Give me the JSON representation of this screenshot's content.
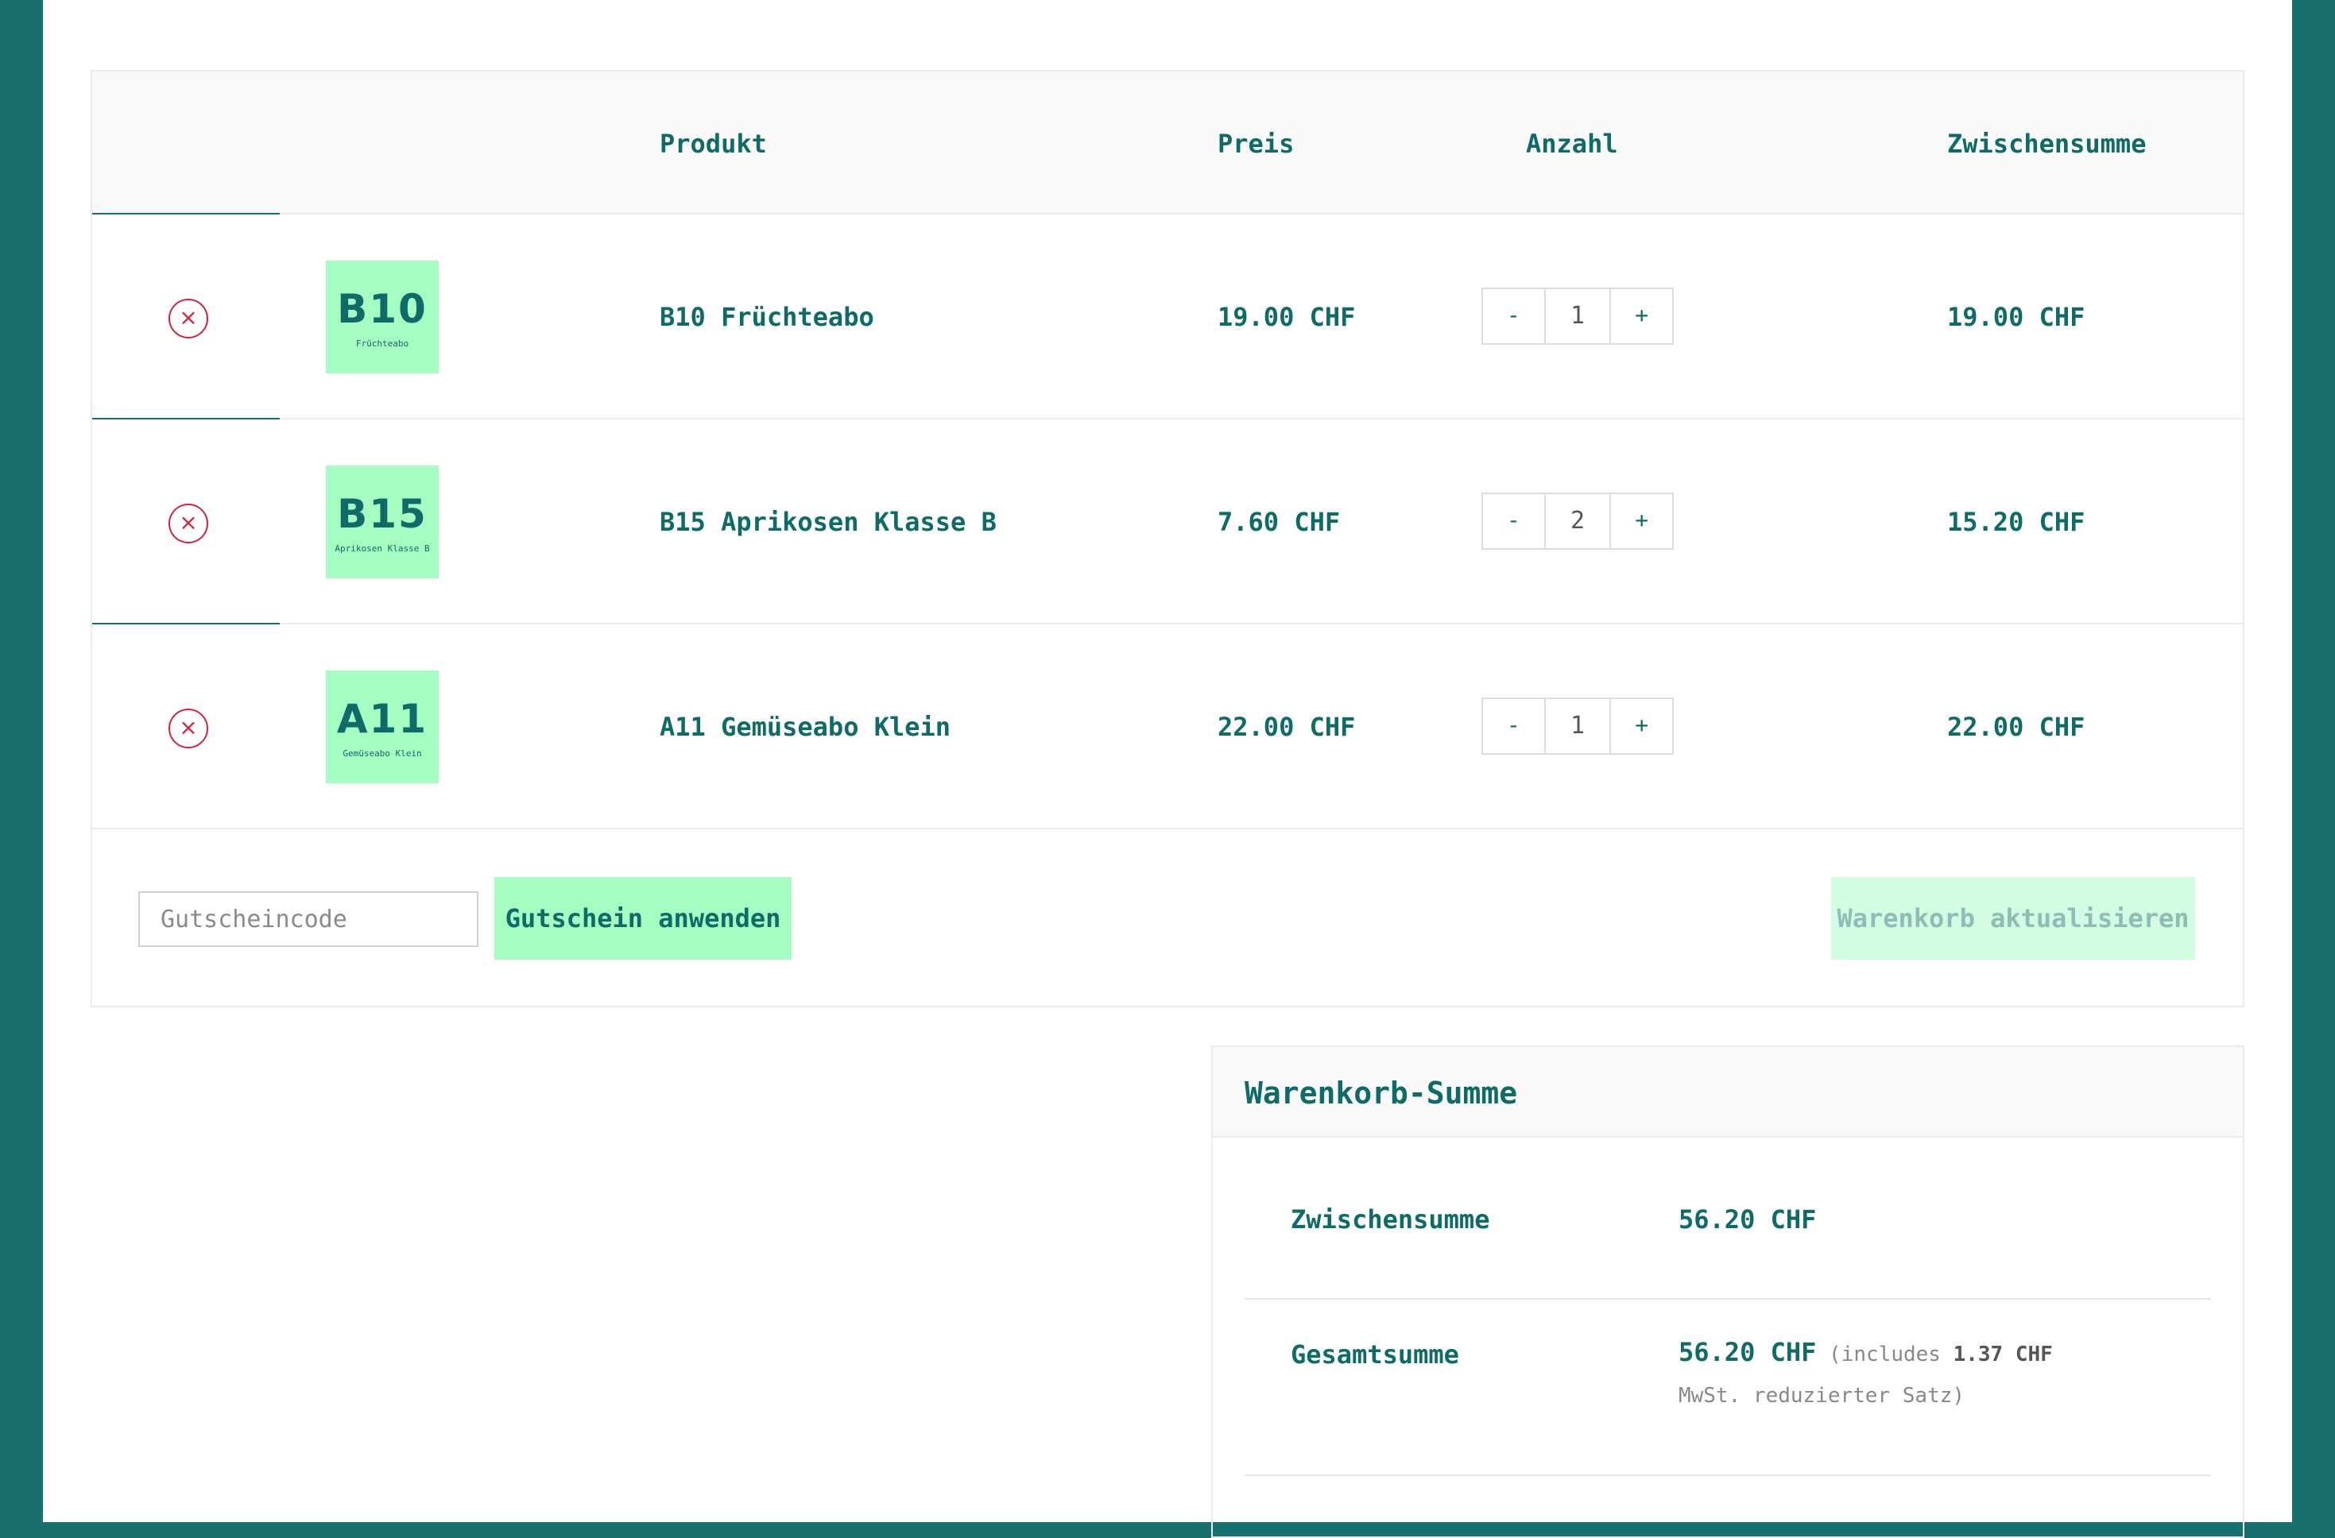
{
  "table": {
    "headers": {
      "product": "Produkt",
      "price": "Preis",
      "quantity": "Anzahl",
      "subtotal": "Zwischensumme"
    },
    "items": [
      {
        "code": "B10",
        "thumb_sub": "Früchteabo",
        "name": "B10 Früchteabo",
        "price": "19.00 CHF",
        "qty": "1",
        "subtotal": "19.00 CHF"
      },
      {
        "code": "B15",
        "thumb_sub": "Aprikosen Klasse B",
        "name": "B15 Aprikosen Klasse B",
        "price": "7.60 CHF",
        "qty": "2",
        "subtotal": "15.20 CHF"
      },
      {
        "code": "A11",
        "thumb_sub": "Gemüseabo Klein",
        "name": "A11 Gemüseabo Klein",
        "price": "22.00 CHF",
        "qty": "1",
        "subtotal": "22.00 CHF"
      }
    ],
    "remove_symbol": "×",
    "minus_label": "-",
    "plus_label": "+"
  },
  "coupon": {
    "placeholder": "Gutscheincode",
    "apply_label": "Gutschein anwenden",
    "update_label": "Warenkorb aktualisieren"
  },
  "totals": {
    "title": "Warenkorb-Summe",
    "subtotal_label": "Zwischensumme",
    "subtotal_value": "56.20 CHF",
    "total_label": "Gesamtsumme",
    "total_value": "56.20 CHF",
    "tax_prefix": "(includes",
    "tax_amount": "1.37 CHF",
    "tax_suffix": "MwSt. reduzierter Satz)"
  },
  "colors": {
    "frame": "#17706e",
    "accent": "#a5fdc2",
    "text": "#0e6b67",
    "remove": "#d0263c"
  }
}
